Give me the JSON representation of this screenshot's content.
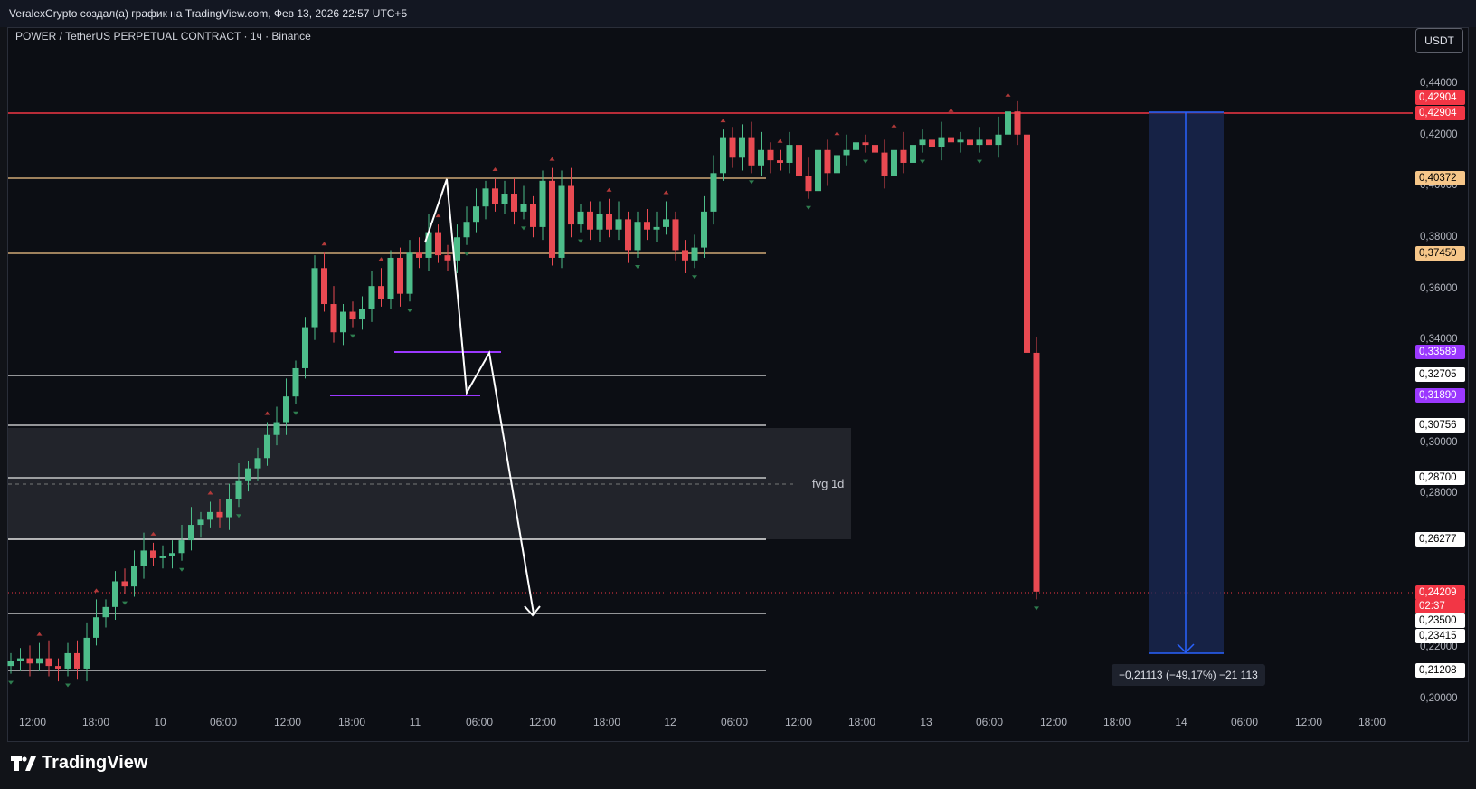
{
  "header": {
    "attribution": "VeralexCrypto создал(а) график на TradingView.com, Фев 13, 2026 22:57 UTC+5"
  },
  "symbol": {
    "title": "POWER / TetherUS PERPETUAL CONTRACT · 1ч · Binance"
  },
  "currency_button": "USDT",
  "price_axis": {
    "ticks": [
      "0,44000",
      "0,42000",
      "0,40000",
      "0,38000",
      "0,36000",
      "0,34000",
      "0,30000",
      "0,28000",
      "0,22000",
      "0,20000"
    ]
  },
  "price_labels": {
    "resistance_a": "0,42904",
    "resistance_b": "0,42904",
    "level_orange_high": "0,40372",
    "level_orange_low": "0,37450",
    "level_purple_high": "0,33589",
    "level_white_1": "0,32705",
    "level_purple_low": "0,31890",
    "level_white_2": "0,30756",
    "level_white_3": "0,28700",
    "level_white_4": "0,26277",
    "current_price": "0,24209",
    "countdown": "02:37",
    "level_white_5": "0,23500",
    "level_white_6": "0,23415",
    "level_white_7": "0,21208"
  },
  "time_axis": [
    "12:00",
    "18:00",
    "10",
    "06:00",
    "12:00",
    "18:00",
    "11",
    "06:00",
    "12:00",
    "18:00",
    "12",
    "06:00",
    "12:00",
    "18:00",
    "13",
    "06:00",
    "12:00",
    "18:00",
    "14",
    "06:00",
    "12:00",
    "18:00"
  ],
  "annotations": {
    "fvg": "fvg 1d",
    "measure": "−0,21113 (−49,17%) −21 113"
  },
  "colors": {
    "bull": "#4dbd8a",
    "bear": "#e94a52",
    "orange_line": "#f6c689",
    "purple_line": "#9b38ff",
    "red_line": "#f23645",
    "measure_blue": "#2962ff"
  },
  "brand": {
    "name": "TradingView"
  }
}
